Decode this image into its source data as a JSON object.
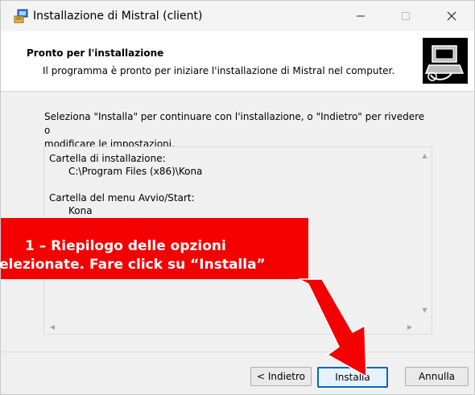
{
  "window": {
    "title": "Installazione di Mistral (client)",
    "controls": [
      "minimize",
      "maximize",
      "close"
    ]
  },
  "header": {
    "title": "Pronto per l'installazione",
    "description": "Il programma è pronto per iniziare l'installazione di Mistral nel computer."
  },
  "intro": {
    "line1": "Seleziona \"Installa\" per continuare con l'installazione, o \"Indietro\" per rivedere o",
    "line2": "modificare le impostazioni."
  },
  "summary": {
    "install_folder_label": "Cartella di installazione:",
    "install_folder_value": "C:\\Program Files (x86)\\Kona",
    "start_menu_label": "Cartella del menu Avvio/Start:",
    "start_menu_value": "Kona"
  },
  "annotation": {
    "line1": "1 – Riepilogo delle opzioni",
    "line2": "selezionate. Fare click su “Installa”"
  },
  "buttons": {
    "back": "< Indietro",
    "install": "Installa",
    "cancel": "Annulla"
  },
  "colors": {
    "annotation_red": "#f50000",
    "accent_blue": "#0067c0"
  },
  "icons": {
    "app": "installer-package-icon",
    "wizard": "computer-install-icon"
  }
}
